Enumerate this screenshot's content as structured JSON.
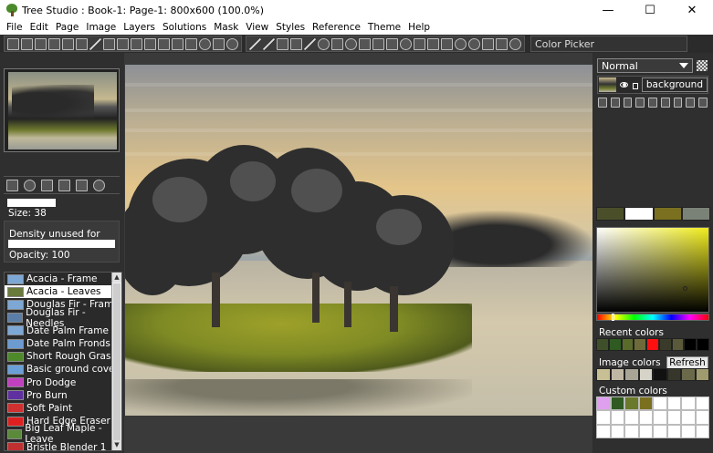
{
  "window": {
    "title": "Tree Studio : Book-1: Page-1: 800x600  (100.0%)",
    "minimize": "—",
    "maximize": "☐",
    "close": "✕"
  },
  "menu": [
    "File",
    "Edit",
    "Page",
    "Image",
    "Layers",
    "Solutions",
    "Mask",
    "View",
    "Styles",
    "Reference",
    "Theme",
    "Help"
  ],
  "toolbar": {
    "tool_label": "Color Picker"
  },
  "brush": {
    "size_label": "Size: 38",
    "size_value": 38,
    "density_label": "Density unused for brush",
    "opacity_label": "Opacity: 100",
    "opacity_value": 100
  },
  "brush_list": {
    "selected_index": 1,
    "items": [
      {
        "label": "Acacia - Frame",
        "color": "#7da8d6"
      },
      {
        "label": "Acacia - Leaves",
        "color": "#6a7a3a"
      },
      {
        "label": "Douglas Fir - Frame",
        "color": "#7da8d6"
      },
      {
        "label": "Douglas Fir - Needles",
        "color": "#5b7ea8"
      },
      {
        "label": "Date Palm Frame",
        "color": "#7da8d6"
      },
      {
        "label": "Date Palm Fronds",
        "color": "#6b9bd0"
      },
      {
        "label": "Short Rough Grass",
        "color": "#4f8a2a"
      },
      {
        "label": "Basic ground cover",
        "color": "#6aa0d8"
      },
      {
        "label": "Pro Dodge",
        "color": "#c040c0"
      },
      {
        "label": "Pro Burn",
        "color": "#6030a0"
      },
      {
        "label": "Soft Paint",
        "color": "#d03030"
      },
      {
        "label": "Hard Edge Eraser",
        "color": "#e02020"
      },
      {
        "label": "Big Leaf Maple - Leave",
        "color": "#5a8a3a"
      },
      {
        "label": "Bristle Blender 1",
        "color": "#c03030"
      }
    ]
  },
  "layers": {
    "blend_mode": "Normal",
    "layer_name": "background"
  },
  "colors": {
    "swatches": [
      "#4a4f2a",
      "#ffffff",
      "#7a7020",
      "#7a8278"
    ],
    "recent_label": "Recent colors",
    "recent": [
      "#3f4f2a",
      "#2f5a22",
      "#5a6a2a",
      "#6e6a3a",
      "#ff1010",
      "#3a3a2a",
      "#5a5a3a",
      "#000000",
      "#000000"
    ],
    "image_label": "Image colors",
    "refresh_label": "Refresh",
    "image": [
      "#c9bf95",
      "#bfb7a3",
      "#a8a496",
      "#d6d4c8",
      "#111111",
      "#36362a",
      "#6a6a4a",
      "#a09b6e"
    ],
    "custom_label": "Custom colors",
    "custom": [
      "#e0a0f0",
      "#2f5a22",
      "#6a7a2a",
      "#7a7020",
      "#ffffff",
      "#ffffff",
      "#ffffff",
      "#ffffff",
      "#ffffff",
      "#ffffff",
      "#ffffff",
      "#ffffff",
      "#ffffff",
      "#ffffff",
      "#ffffff",
      "#ffffff",
      "#ffffff",
      "#ffffff",
      "#ffffff",
      "#ffffff",
      "#ffffff",
      "#ffffff",
      "#ffffff",
      "#ffffff"
    ]
  }
}
